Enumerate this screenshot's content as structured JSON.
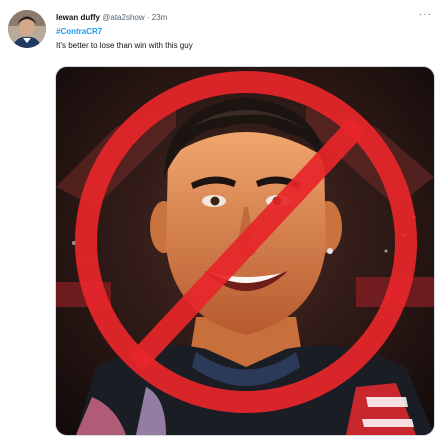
{
  "tweet": {
    "author": {
      "display_name": "lewan duffy",
      "handle": "@ata2show",
      "separator": "·",
      "time": "23m"
    },
    "hashtag": "#ContraCR7",
    "text": "It's better to lose than win with this guy",
    "more_icon": "more-horizontal-icon",
    "more_glyph": "···"
  },
  "media": {
    "kind": "photo",
    "overlay_icon": "prohibition-sign-icon",
    "colors": {
      "prohibition_red": "#e8262a",
      "background_red": "#b8242a",
      "jersey_red": "#c9272e"
    }
  },
  "colors": {
    "text_primary": "#0f1419",
    "text_secondary": "#536471",
    "link_blue": "#1d9bf0"
  }
}
